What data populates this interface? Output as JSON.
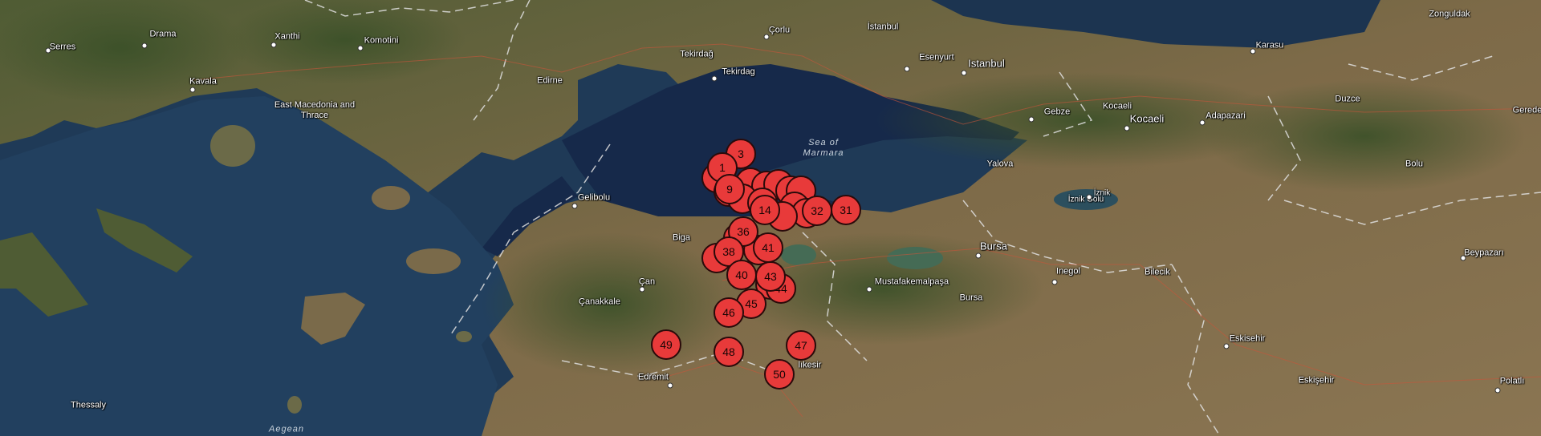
{
  "map": {
    "regions": [
      {
        "id": "east-macedonia",
        "label": "East Macedonia and Thrace"
      },
      {
        "id": "thessaly",
        "label": "Thessaly"
      }
    ],
    "water": [
      {
        "id": "sea-of-marmara",
        "label": "Sea of Marmara"
      },
      {
        "id": "aegean",
        "label": "Aegean"
      },
      {
        "id": "iznik-golu",
        "label": "İznik Gölü"
      }
    ],
    "places": [
      {
        "id": "serres",
        "label": "Serres"
      },
      {
        "id": "drama",
        "label": "Drama"
      },
      {
        "id": "xanthi",
        "label": "Xanthi"
      },
      {
        "id": "komotini",
        "label": "Komotini"
      },
      {
        "id": "kavala",
        "label": "Kavala"
      },
      {
        "id": "edirne",
        "label": "Edirne"
      },
      {
        "id": "tekirdag-prov",
        "label": "Tekirdağ"
      },
      {
        "id": "tekirdag",
        "label": "Tekirdag"
      },
      {
        "id": "corlu",
        "label": "Çorlu"
      },
      {
        "id": "istanbul-prov",
        "label": "İstanbul"
      },
      {
        "id": "istanbul",
        "label": "Istanbul"
      },
      {
        "id": "esenyurt",
        "label": "Esenyurt"
      },
      {
        "id": "zonguldak",
        "label": "Zonguldak"
      },
      {
        "id": "karasu",
        "label": "Karasu"
      },
      {
        "id": "gebze",
        "label": "Gebze"
      },
      {
        "id": "kocaeli-prov",
        "label": "Kocaeli"
      },
      {
        "id": "kocaeli",
        "label": "Kocaeli"
      },
      {
        "id": "adapazari",
        "label": "Adapazari"
      },
      {
        "id": "duzce",
        "label": "Duzce"
      },
      {
        "id": "gerede",
        "label": "Gerede"
      },
      {
        "id": "yalova",
        "label": "Yalova"
      },
      {
        "id": "iznik",
        "label": "İznik"
      },
      {
        "id": "bolu",
        "label": "Bolu"
      },
      {
        "id": "gelibolu",
        "label": "Gelibolu"
      },
      {
        "id": "biga",
        "label": "Biga"
      },
      {
        "id": "can",
        "label": "Çan"
      },
      {
        "id": "canakkale",
        "label": "Çanakkale"
      },
      {
        "id": "bursa",
        "label": "Bursa"
      },
      {
        "id": "bursa-prov",
        "label": "Bursa"
      },
      {
        "id": "mustafakemalpasa",
        "label": "Mustafakemalpaşa"
      },
      {
        "id": "inegol",
        "label": "Inegol"
      },
      {
        "id": "bilecik",
        "label": "Bilecik"
      },
      {
        "id": "beypazari",
        "label": "Beypazarı"
      },
      {
        "id": "eskisehir-prov",
        "label": "Eskisehir"
      },
      {
        "id": "eskisehir",
        "label": "Eskişehir"
      },
      {
        "id": "polatli",
        "label": "Polatlı"
      },
      {
        "id": "edremit",
        "label": "Edremit"
      },
      {
        "id": "balikesir",
        "label": "lıkesir"
      }
    ],
    "markers": [
      "1",
      "3",
      "9",
      "14",
      "31",
      "32",
      "36",
      "41",
      "38",
      "40",
      "43",
      "44",
      "45",
      "46",
      "47",
      "48",
      "49",
      "50"
    ],
    "colors": {
      "marker": "#e83a3a",
      "sea": "#1d3550",
      "land": "#7d6a48",
      "forest": "#3f5530"
    }
  }
}
